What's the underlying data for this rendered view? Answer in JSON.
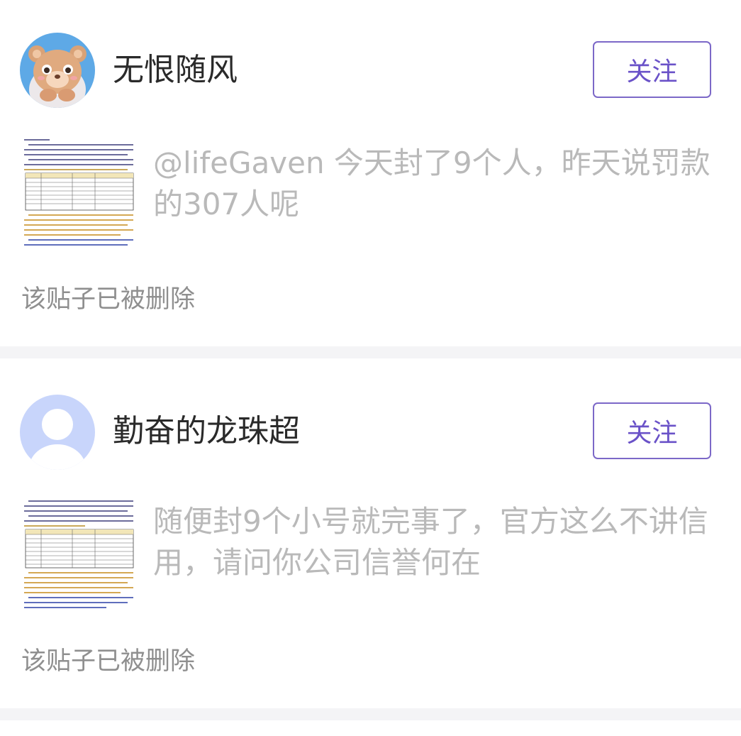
{
  "posts": [
    {
      "username": "无恨随风",
      "follow_label": "关注",
      "avatar": "bear-avatar",
      "content": "@lifeGaven 今天封了9个人，昨天说罚款的307人呢",
      "deleted_note": "该贴子已被删除",
      "thumbnail": "document-screenshot-thumbnail"
    },
    {
      "username": "勤奋的龙珠超",
      "follow_label": "关注",
      "avatar": "default-user-avatar",
      "content": "随便封9个小号就完事了，官方这么不讲信用，请问你公司信誉何在",
      "deleted_note": "该贴子已被删除",
      "thumbnail": "document-screenshot-thumbnail"
    }
  ],
  "colors": {
    "accent": "#7c68c8",
    "username": "#2a2a2a",
    "content": "#b9b9b9",
    "deleted": "#8f8f8f",
    "separator": "#f4f4f6"
  }
}
